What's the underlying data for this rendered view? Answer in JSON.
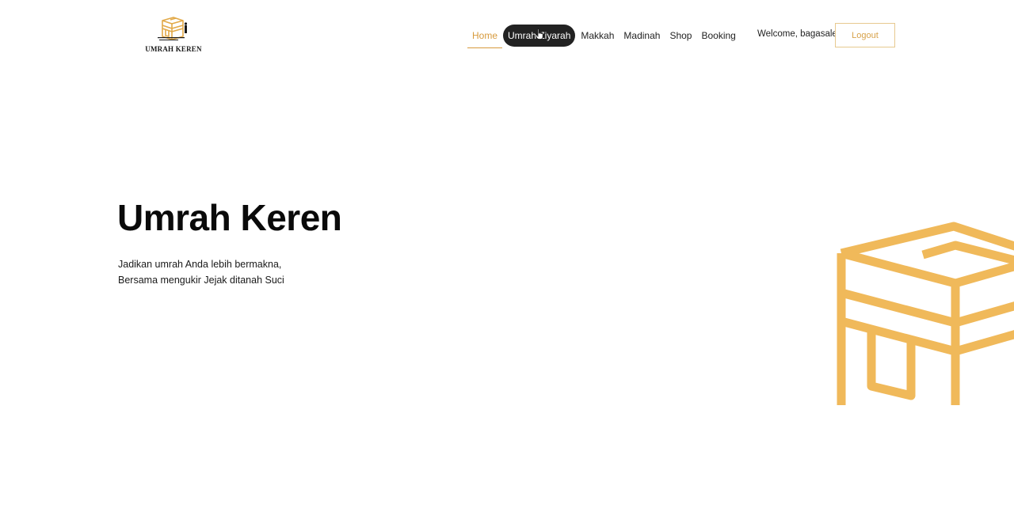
{
  "brand": {
    "name": "UMRAH KEREN",
    "accent_color": "#f0b95a",
    "logo_icon": "kaaba-logo-icon"
  },
  "nav": {
    "items": [
      {
        "label": "Home"
      },
      {
        "label": "Umrah Ziyarah"
      },
      {
        "label": "Makkah"
      },
      {
        "label": "Madinah"
      },
      {
        "label": "Shop"
      },
      {
        "label": "Booking"
      }
    ],
    "active": "Home",
    "hovered": "Umrah Ziyarah"
  },
  "user": {
    "welcome_text": "Welcome, bagasale",
    "logout_label": "Logout"
  },
  "hero": {
    "title": "Umrah Keren",
    "subtitle_line1": "Jadikan umrah Anda lebih bermakna,",
    "subtitle_line2": "Bersama mengukir Jejak ditanah Suci",
    "illustration": "kaaba-illustration"
  }
}
